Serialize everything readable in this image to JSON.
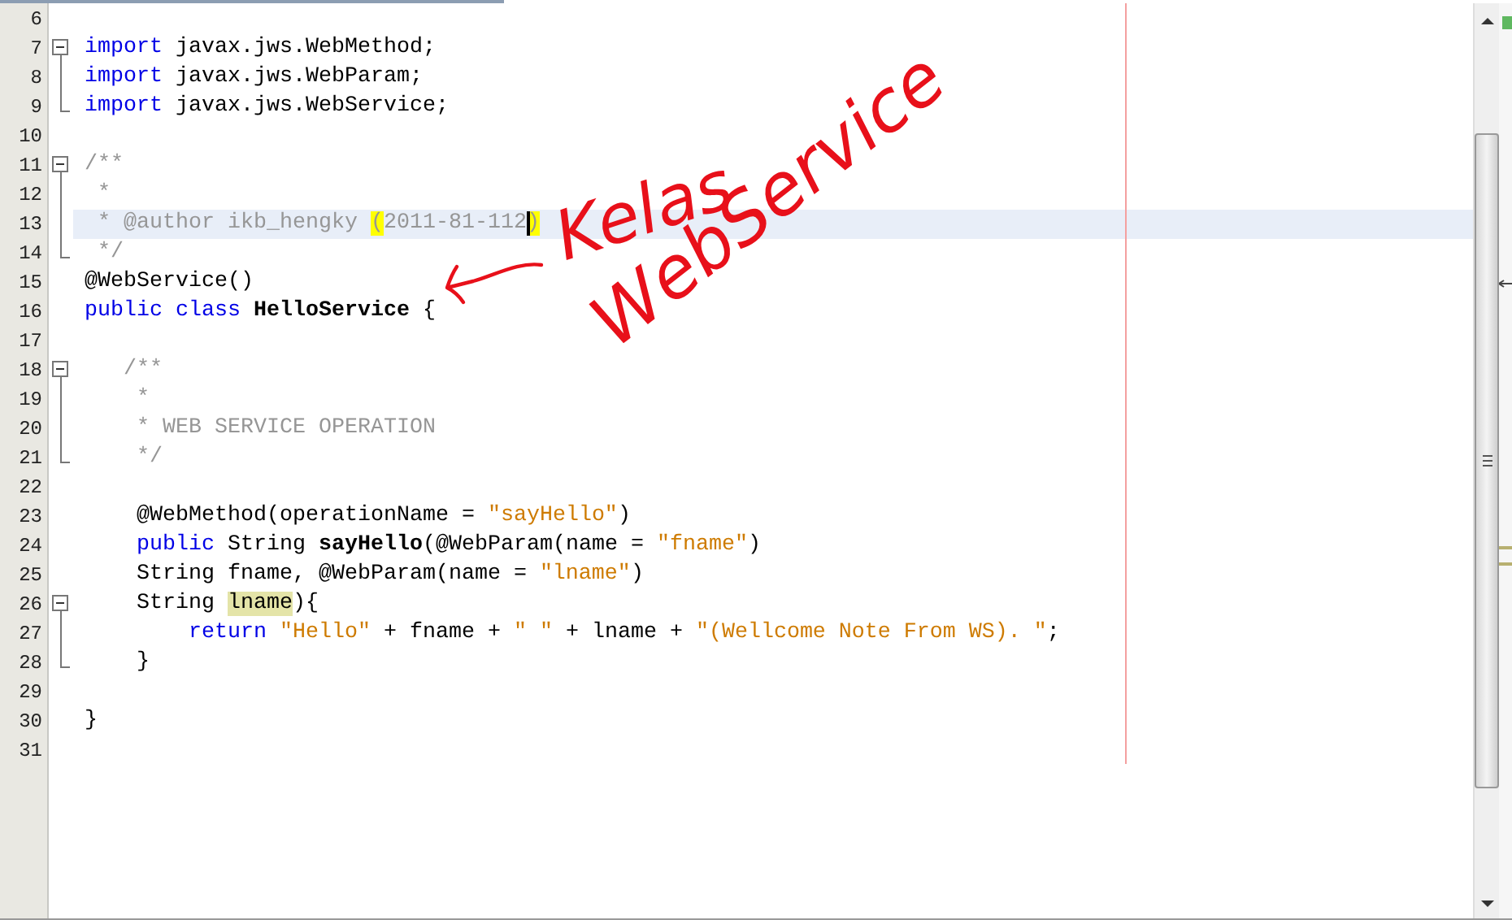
{
  "editor": {
    "lines": [
      {
        "num": "6",
        "kind": "plain",
        "current": false
      },
      {
        "num": "7",
        "kind": "opener",
        "current": false,
        "tokens": [
          {
            "t": "import",
            "kind": "kw"
          },
          {
            "t": " javax.jws.WebMethod;",
            "kind": "id"
          }
        ]
      },
      {
        "num": "8",
        "kind": "inside",
        "current": false,
        "tokens": [
          {
            "t": "import",
            "kind": "kw"
          },
          {
            "t": " javax.jws.WebParam;",
            "kind": "id"
          }
        ]
      },
      {
        "num": "9",
        "kind": "closer",
        "current": false,
        "tokens": [
          {
            "t": "import",
            "kind": "kw"
          },
          {
            "t": " javax.jws.WebService;",
            "kind": "id"
          }
        ]
      },
      {
        "num": "10",
        "kind": "plain",
        "current": false
      },
      {
        "num": "11",
        "kind": "opener",
        "current": false,
        "tokens": [
          {
            "t": "/**",
            "kind": "cm"
          }
        ]
      },
      {
        "num": "12",
        "kind": "inside",
        "current": false,
        "tokens": [
          {
            "t": " *",
            "kind": "cm"
          }
        ]
      },
      {
        "num": "13",
        "kind": "inside",
        "current": true,
        "tokens": [
          {
            "t": " * @author ikb_hengky ",
            "kind": "cm"
          },
          {
            "t": "(",
            "kind": "match"
          },
          {
            "t": "2011-81-112",
            "kind": "cm"
          },
          {
            "t": ")",
            "kind": "caret"
          }
        ]
      },
      {
        "num": "14",
        "kind": "closer",
        "current": false,
        "tokens": [
          {
            "t": " */",
            "kind": "cm"
          }
        ]
      },
      {
        "num": "15",
        "kind": "plain",
        "current": false,
        "tokens": [
          {
            "t": "@WebService()",
            "kind": "id"
          }
        ]
      },
      {
        "num": "16",
        "kind": "plain",
        "current": false,
        "tokens": [
          {
            "t": "public class",
            "kind": "kw"
          },
          {
            "t": " HelloService",
            "kind": "bold"
          },
          {
            "t": " {",
            "kind": "id"
          }
        ]
      },
      {
        "num": "17",
        "kind": "plain",
        "current": false
      },
      {
        "num": "18",
        "kind": "opener",
        "current": false,
        "tokens": [
          {
            "t": "   /**",
            "kind": "cm"
          }
        ]
      },
      {
        "num": "19",
        "kind": "inside",
        "current": false,
        "tokens": [
          {
            "t": "    *",
            "kind": "cm"
          }
        ]
      },
      {
        "num": "20",
        "kind": "inside",
        "current": false,
        "tokens": [
          {
            "t": "    * WEB SERVICE OPERATION",
            "kind": "cm"
          }
        ]
      },
      {
        "num": "21",
        "kind": "closer",
        "current": false,
        "tokens": [
          {
            "t": "    */",
            "kind": "cm"
          }
        ]
      },
      {
        "num": "22",
        "kind": "plain",
        "current": false
      },
      {
        "num": "23",
        "kind": "plain",
        "current": false,
        "tokens": [
          {
            "t": "    @WebMethod(operationName = ",
            "kind": "id"
          },
          {
            "t": "\"sayHello\"",
            "kind": "str"
          },
          {
            "t": ")",
            "kind": "id"
          }
        ]
      },
      {
        "num": "24",
        "kind": "plain",
        "current": false,
        "tokens": [
          {
            "t": "    public",
            "kind": "kw"
          },
          {
            "t": " String ",
            "kind": "id"
          },
          {
            "t": "sayHello",
            "kind": "bold"
          },
          {
            "t": "(@WebParam(name = ",
            "kind": "id"
          },
          {
            "t": "\"fname\"",
            "kind": "str"
          },
          {
            "t": ")",
            "kind": "id"
          }
        ]
      },
      {
        "num": "25",
        "kind": "plain",
        "current": false,
        "tokens": [
          {
            "t": "    String fname, @WebParam(name = ",
            "kind": "id"
          },
          {
            "t": "\"lname\"",
            "kind": "str"
          },
          {
            "t": ")",
            "kind": "id"
          }
        ]
      },
      {
        "num": "26",
        "kind": "opener",
        "current": false,
        "tokens": [
          {
            "t": "    String ",
            "kind": "id"
          },
          {
            "t": "lname",
            "kind": "hl"
          },
          {
            "t": "){",
            "kind": "id"
          }
        ]
      },
      {
        "num": "27",
        "kind": "inside",
        "current": false,
        "tokens": [
          {
            "t": "        return",
            "kind": "kw"
          },
          {
            "t": " \"Hello\"",
            "kind": "str"
          },
          {
            "t": " + fname + ",
            "kind": "id"
          },
          {
            "t": "\" \"",
            "kind": "str"
          },
          {
            "t": " + lname + ",
            "kind": "id"
          },
          {
            "t": "\"(Wellcome Note From WS). \"",
            "kind": "str"
          },
          {
            "t": ";",
            "kind": "id"
          }
        ]
      },
      {
        "num": "28",
        "kind": "closer",
        "current": false,
        "tokens": [
          {
            "t": "    }",
            "kind": "id"
          }
        ]
      },
      {
        "num": "29",
        "kind": "plain",
        "current": false
      },
      {
        "num": "30",
        "kind": "plain",
        "current": false,
        "tokens": [
          {
            "t": "}",
            "kind": "id"
          }
        ]
      },
      {
        "num": "31",
        "kind": "plain",
        "current": false
      }
    ]
  },
  "annotation": {
    "line_1": "Kelas",
    "line_2": "WebService"
  }
}
